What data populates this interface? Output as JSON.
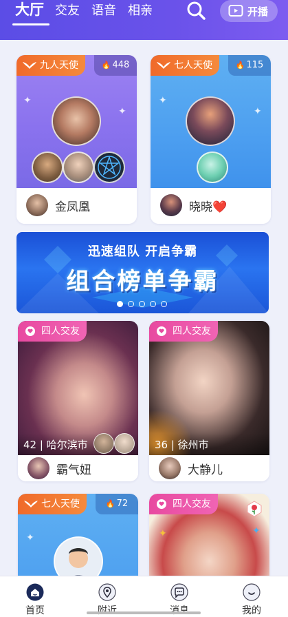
{
  "header": {
    "tabs": [
      {
        "label": "大厅",
        "active": true
      },
      {
        "label": "交友",
        "active": false
      },
      {
        "label": "语音",
        "active": false
      },
      {
        "label": "相亲",
        "active": false
      }
    ],
    "search_icon": "search-icon",
    "live_button_label": "开播",
    "accent_color": "#5b4de6"
  },
  "rooms_top": [
    {
      "badge": "九人天使",
      "badge_icon": "wings-icon",
      "heat": "448",
      "host": "金凤凰"
    },
    {
      "badge": "七人天使",
      "badge_icon": "wings-icon",
      "heat": "115",
      "host": "晓晓",
      "host_suffix": "❤️"
    }
  ],
  "banner": {
    "subtitle": "迅速组队 开启争霸",
    "title": "组合榜单争霸",
    "slide_count": 5,
    "active_slide": 1
  },
  "rooms_middle": [
    {
      "badge": "四人交友",
      "badge_icon": "chat-heart-icon",
      "info": "42 | 哈尔滨市",
      "host": "霸气妞"
    },
    {
      "badge": "四人交友",
      "badge_icon": "chat-heart-icon",
      "info": "36 | 徐州市",
      "host": "大静儿"
    }
  ],
  "rooms_bottom": [
    {
      "badge": "七人天使",
      "badge_icon": "wings-icon",
      "heat": "72"
    },
    {
      "badge": "四人交友",
      "badge_icon": "chat-heart-icon"
    }
  ],
  "bottom_nav": [
    {
      "label": "首页",
      "icon": "home-icon",
      "active": true
    },
    {
      "label": "附近",
      "icon": "location-icon",
      "active": false
    },
    {
      "label": "消息",
      "icon": "message-icon",
      "active": false
    },
    {
      "label": "我的",
      "icon": "profile-icon",
      "active": false
    }
  ]
}
